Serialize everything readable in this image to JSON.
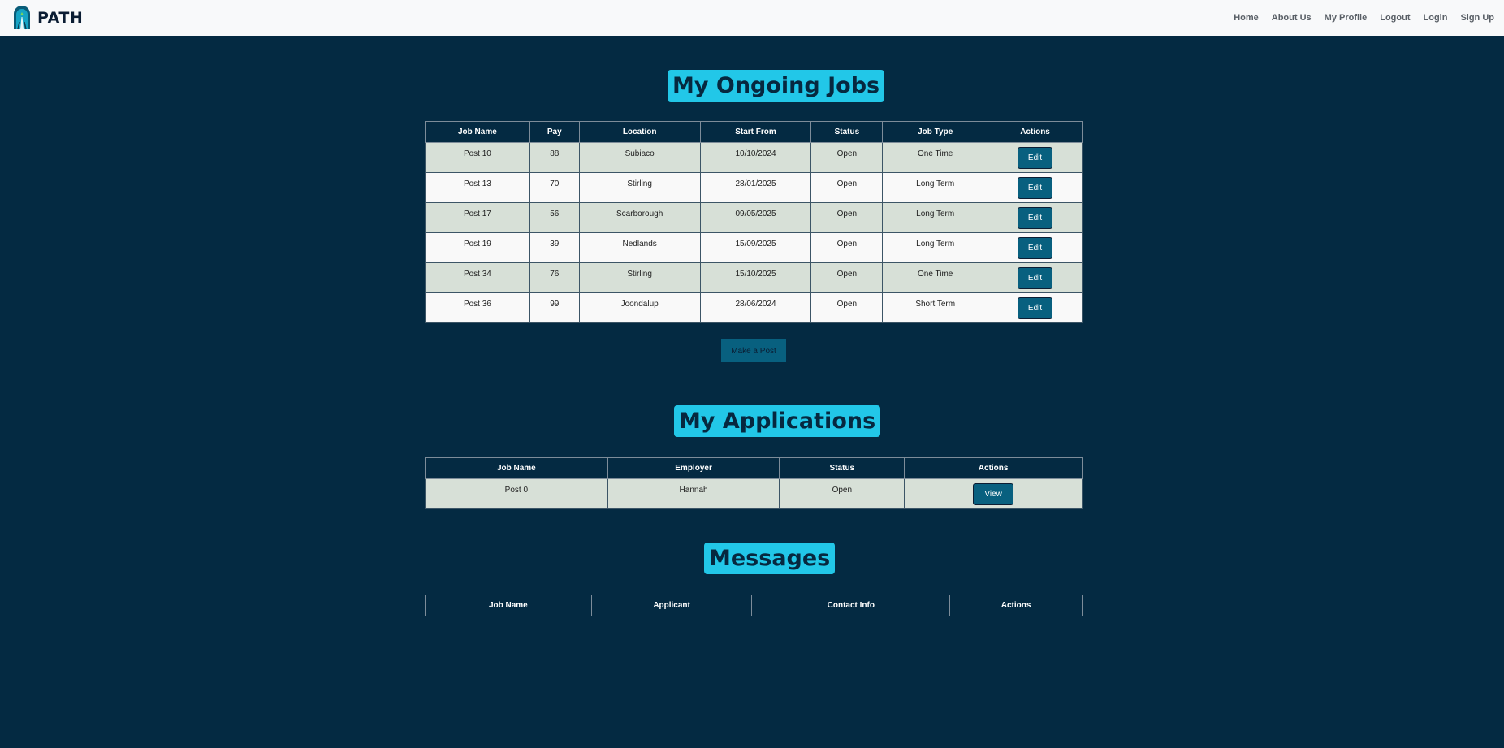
{
  "nav": {
    "brand": "PATH",
    "links": [
      "Home",
      "About Us",
      "My Profile",
      "Logout",
      "Login",
      "Sign Up"
    ]
  },
  "jobs": {
    "title": "My Ongoing Jobs",
    "headers": [
      "Job Name",
      "Pay",
      "Location",
      "Start From",
      "Status",
      "Job Type",
      "Actions"
    ],
    "rows": [
      {
        "name": "Post 10",
        "pay": "88",
        "location": "Subiaco",
        "start": "10/10/2024",
        "status": "Open",
        "type": "One Time",
        "action": "Edit"
      },
      {
        "name": "Post 13",
        "pay": "70",
        "location": "Stirling",
        "start": "28/01/2025",
        "status": "Open",
        "type": "Long Term",
        "action": "Edit"
      },
      {
        "name": "Post 17",
        "pay": "56",
        "location": "Scarborough",
        "start": "09/05/2025",
        "status": "Open",
        "type": "Long Term",
        "action": "Edit"
      },
      {
        "name": "Post 19",
        "pay": "39",
        "location": "Nedlands",
        "start": "15/09/2025",
        "status": "Open",
        "type": "Long Term",
        "action": "Edit"
      },
      {
        "name": "Post 34",
        "pay": "76",
        "location": "Stirling",
        "start": "15/10/2025",
        "status": "Open",
        "type": "One Time",
        "action": "Edit"
      },
      {
        "name": "Post 36",
        "pay": "99",
        "location": "Joondalup",
        "start": "28/06/2024",
        "status": "Open",
        "type": "Short Term",
        "action": "Edit"
      }
    ],
    "make_post_label": "Make a Post"
  },
  "applications": {
    "title": "My Applications",
    "headers": [
      "Job Name",
      "Employer",
      "Status",
      "Actions"
    ],
    "rows": [
      {
        "name": "Post 0",
        "employer": "Hannah",
        "status": "Open",
        "action": "View"
      }
    ]
  },
  "messages": {
    "title": "Messages",
    "headers": [
      "Job Name",
      "Applicant",
      "Contact Info",
      "Actions"
    ]
  },
  "colors": {
    "page_bg": "#042a42",
    "title_bg": "#22c7e8",
    "button_bg": "#08607f",
    "row_odd": "#d7e0d7",
    "row_even": "#f9f9f9"
  }
}
